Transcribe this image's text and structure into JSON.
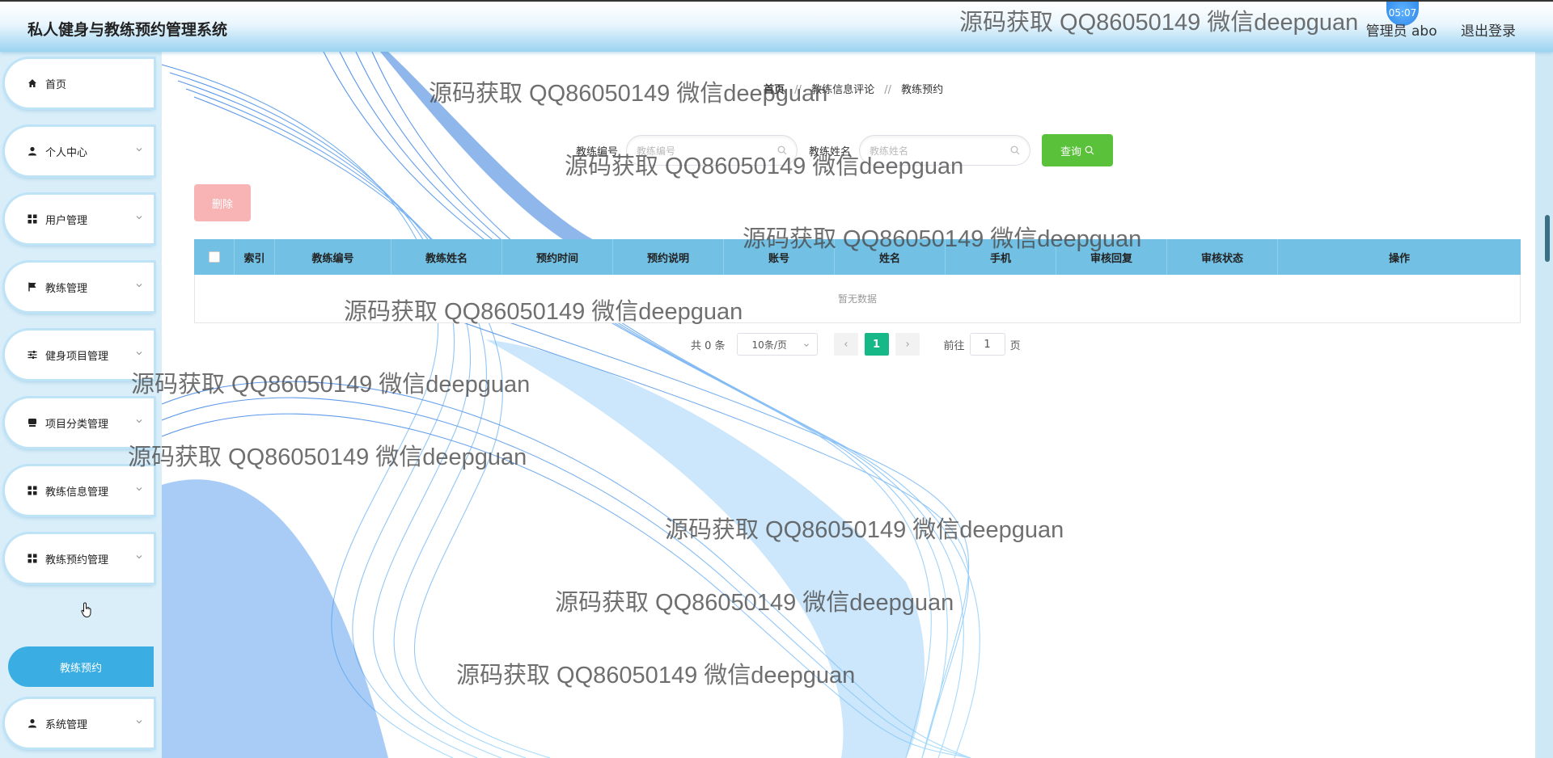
{
  "app": {
    "title": "私人健身与教练预约管理系统"
  },
  "header": {
    "user_label": "管理员 abo",
    "logout_label": "退出登录",
    "clock": "05:07"
  },
  "sidebar": {
    "items": [
      {
        "label": "首页",
        "icon": "home-icon"
      },
      {
        "label": "个人中心",
        "icon": "user-icon"
      },
      {
        "label": "用户管理",
        "icon": "grid-icon"
      },
      {
        "label": "教练管理",
        "icon": "flag-icon"
      },
      {
        "label": "健身项目管理",
        "icon": "sliders-icon"
      },
      {
        "label": "项目分类管理",
        "icon": "box-icon"
      },
      {
        "label": "教练信息管理",
        "icon": "grid-icon"
      },
      {
        "label": "教练预约管理",
        "icon": "grid-icon"
      },
      {
        "label": "系统管理",
        "icon": "user-icon"
      }
    ],
    "active_sub": "教练预约"
  },
  "breadcrumb": {
    "home": "首页",
    "sep": "//",
    "level1": "教练信息评论",
    "level2": "教练预约"
  },
  "search": {
    "code_label": "教练编号",
    "code_placeholder": "教练编号",
    "name_label": "教练姓名",
    "name_placeholder": "教练姓名",
    "query_label": "查询"
  },
  "actions": {
    "delete_label": "删除"
  },
  "table": {
    "columns": [
      "索引",
      "教练编号",
      "教练姓名",
      "预约时间",
      "预约说明",
      "账号",
      "姓名",
      "手机",
      "审核回复",
      "审核状态",
      "操作"
    ],
    "empty_text": "暂无数据"
  },
  "pagination": {
    "total_text": "共 0 条",
    "page_size": "10条/页",
    "current_page": "1",
    "goto_prefix": "前往",
    "goto_value": "1",
    "goto_suffix": "页"
  },
  "watermark": "源码获取 QQ86050149 微信deepguan",
  "colors": {
    "header_gradient_end": "#9bd4f1",
    "table_header": "#72c0e4",
    "query_button": "#5ac13a",
    "delete_button": "#f8b4b4",
    "active_sub_item": "#3aaee3",
    "active_page": "#17b887"
  }
}
